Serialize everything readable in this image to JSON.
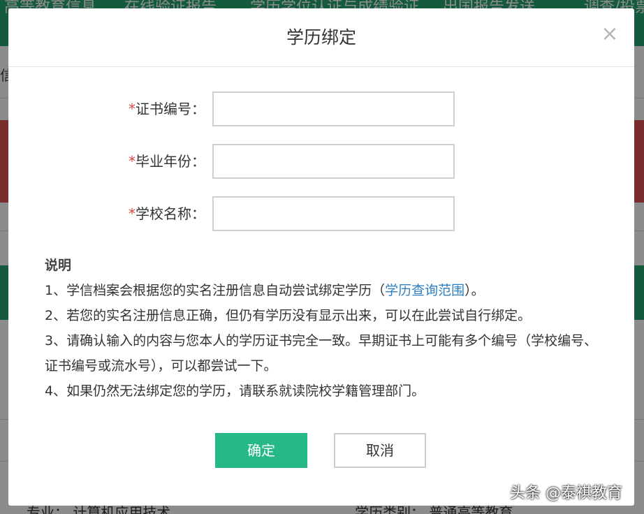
{
  "background": {
    "nav_items": [
      "高等教育信息",
      "在线验证报告",
      "学历学位认证与成绩验证",
      "出国报告发送",
      "调查/投票"
    ],
    "side_char": "信",
    "bottom_left": "专业：  计算机应用技术",
    "bottom_right": "学历类别：  普通高等教育"
  },
  "modal": {
    "title": "学历绑定",
    "close_symbol": "×",
    "form": {
      "required_mark": "*",
      "fields": [
        {
          "label": "证书编号：",
          "value": "",
          "placeholder": ""
        },
        {
          "label": "毕业年份：",
          "value": "",
          "placeholder": ""
        },
        {
          "label": "学校名称：",
          "value": "",
          "placeholder": ""
        }
      ]
    },
    "notes": {
      "title": "说明",
      "item1_before": "1、学信档案会根据您的实名注册信息自动尝试绑定学历（",
      "item1_link": "学历查询范围",
      "item1_after": "）。",
      "item2": "2、若您的实名注册信息正确，但仍有学历没有显示出来，可以在此尝试自行绑定。",
      "item3": "3、请确认输入的内容与您本人的学历证书完全一致。早期证书上可能有多个编号（学校编号、证书编号或流水号），可以都尝试一下。",
      "item4": "4、如果仍然无法绑定您的学历，请联系就读院校学籍管理部门。"
    },
    "buttons": {
      "confirm": "确定",
      "cancel": "取消"
    }
  },
  "watermark": "头条 @泰祺教育",
  "colors": {
    "primary_green": "#26b888",
    "required_red": "#e0463a",
    "link_blue": "#2d7fc1",
    "nav_green": "#25a46e"
  }
}
